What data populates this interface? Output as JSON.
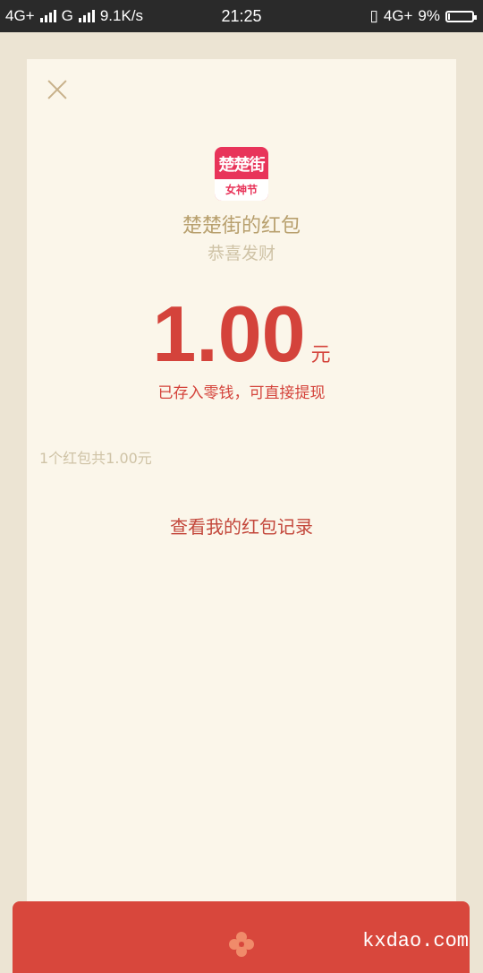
{
  "status_bar": {
    "network1": "4G+",
    "network2": "G",
    "speed": "9.1K/s",
    "time": "21:25",
    "network3": "4G+",
    "battery_percent": "9%",
    "battery_level": 0.09
  },
  "header": {
    "close_icon": "close-icon"
  },
  "logo": {
    "brand": "楚楚街",
    "tag": "女神节"
  },
  "packet": {
    "title": "楚楚街的红包",
    "subtitle": "恭喜发财",
    "amount": "1.00",
    "unit": "元",
    "note": "已存入零钱，可直接提现",
    "count_text": "1个红包共1.00元",
    "records_link": "查看我的红包记录"
  },
  "watermark": "kxdao.com",
  "colors": {
    "accent": "#d4433b",
    "card": "#fbf6ea",
    "background": "#ece4d3",
    "gold": "#b8a06e"
  }
}
